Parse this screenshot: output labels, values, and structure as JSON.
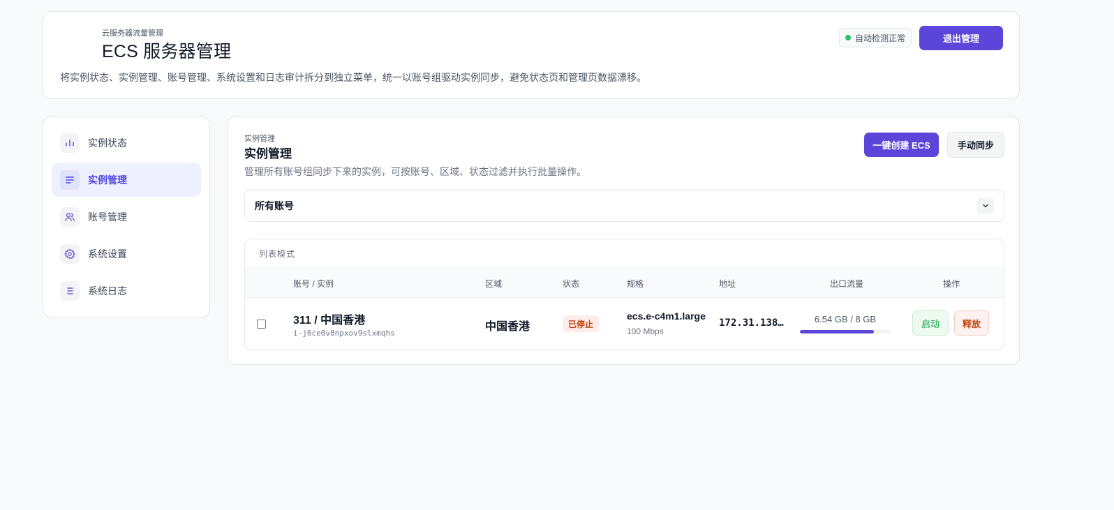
{
  "header": {
    "eyebrow": "云服务器流量管理",
    "title": "ECS 服务器管理",
    "description": "将实例状态、实例管理、账号管理、系统设置和日志审计拆分到独立菜单，统一以账号组驱动实例同步，避免状态页和管理页数据漂移。",
    "status_text": "自动检测正常",
    "exit_label": "退出管理"
  },
  "sidebar": {
    "items": [
      {
        "label": "实例状态",
        "icon": "bar-chart-icon",
        "active": false
      },
      {
        "label": "实例管理",
        "icon": "list-icon",
        "active": true
      },
      {
        "label": "账号管理",
        "icon": "users-icon",
        "active": false
      },
      {
        "label": "系统设置",
        "icon": "gear-icon",
        "active": false
      },
      {
        "label": "系统日志",
        "icon": "log-list-icon",
        "active": false
      }
    ]
  },
  "main": {
    "eyebrow": "实例管理",
    "title": "实例管理",
    "description": "管理所有账号组同步下来的实例，可按账号、区域、状态过滤并执行批量操作。",
    "create_label": "一键创建 ECS",
    "sync_label": "手动同步",
    "account_filter": "所有账号",
    "list_mode": "列表模式",
    "columns": [
      "账号 / 实例",
      "区域",
      "状态",
      "规格",
      "地址",
      "出口流量",
      "操作"
    ],
    "rows": [
      {
        "name": "311 / 中国香港",
        "id": "i-j6ce0v8npxov9slxmqhs",
        "region": "中国香港",
        "status": "已停止",
        "spec": "ecs.e-c4m1.large",
        "bandwidth": "100 Mbps",
        "address": "172.31.138…",
        "traffic": "6.54 GB / 8 GB",
        "traffic_fraction": 0.8175,
        "start_label": "启动",
        "release_label": "释放"
      }
    ]
  },
  "colors": {
    "accent": "#5b46d9",
    "success": "#22c55e",
    "danger": "#c2410c"
  }
}
